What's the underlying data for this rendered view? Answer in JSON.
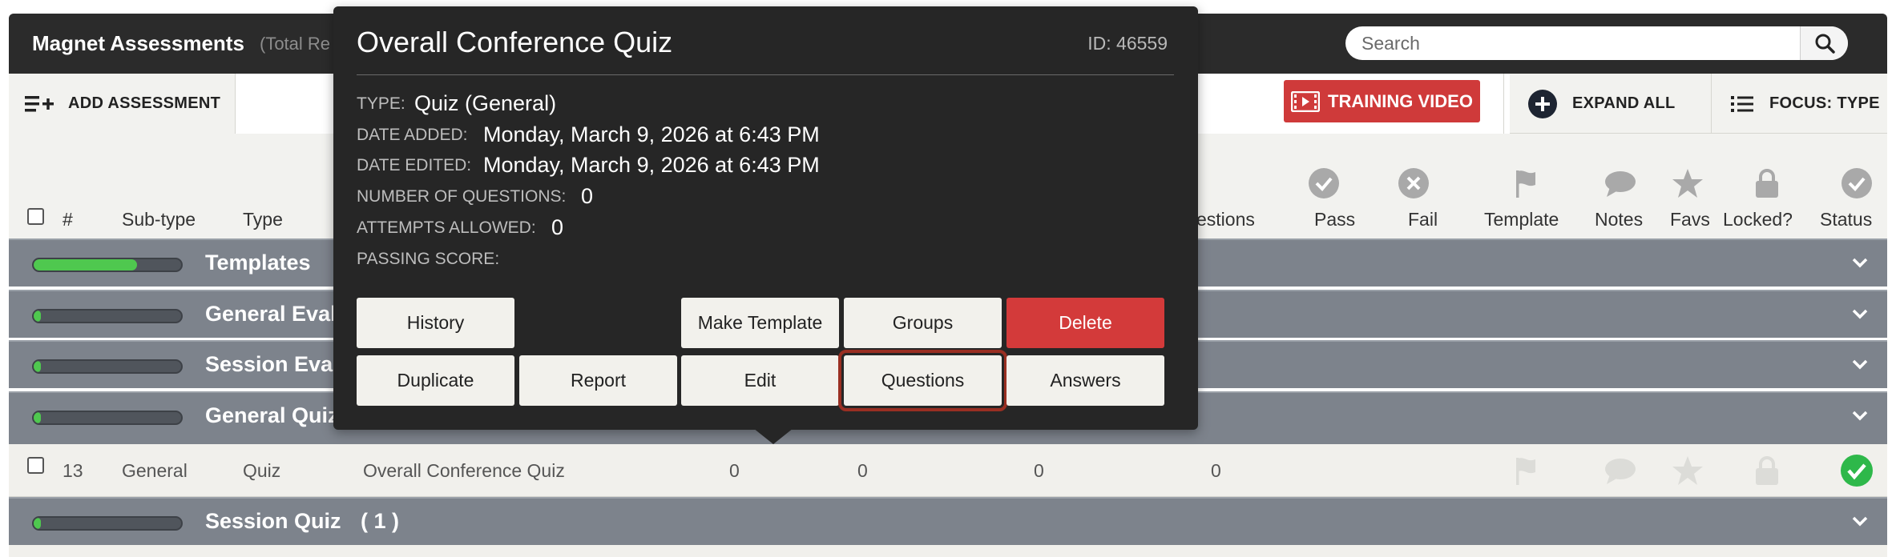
{
  "header": {
    "title": "Magnet Assessments",
    "subtitle": "(Total Re",
    "search_placeholder": "Search"
  },
  "toolbar": {
    "add_label": "ADD ASSESSMENT",
    "training_label": "TRAINING VIDEO",
    "expand_label": "EXPAND ALL",
    "focus_label": "FOCUS: TYPE"
  },
  "columns": {
    "num": "#",
    "subtype": "Sub-type",
    "type": "Type",
    "questions_partial": "estions",
    "pass": "Pass",
    "fail": "Fail",
    "template": "Template",
    "notes": "Notes",
    "favs": "Favs",
    "locked": "Locked?",
    "status": "Status"
  },
  "groups": [
    {
      "label": "Templates",
      "count": "(",
      "progress": 0.7
    },
    {
      "label": "General Eval",
      "progress": 0.05
    },
    {
      "label": "Session Evalu",
      "progress": 0.05
    },
    {
      "label": "General Quiz",
      "progress": 0.05
    },
    {
      "label": "Session Quiz",
      "count": "( 1 )",
      "progress": 0.05
    }
  ],
  "row": {
    "num": "13",
    "subtype": "General",
    "type": "Quiz",
    "name": "Overall Conference Quiz",
    "v1": "0",
    "v2": "0",
    "v3": "0",
    "v4": "0"
  },
  "popover": {
    "title": "Overall Conference Quiz",
    "id": "ID: 46559",
    "fields": [
      {
        "label": "TYPE:",
        "value": "Quiz (General)"
      },
      {
        "label": "DATE ADDED:",
        "value": "Monday, March 9, 2026 at 6:43 PM"
      },
      {
        "label": "DATE EDITED:",
        "value": "Monday, March 9, 2026 at 6:43 PM"
      },
      {
        "label": "NUMBER OF QUESTIONS:",
        "value": "0"
      },
      {
        "label": "ATTEMPTS ALLOWED:",
        "value": "0"
      },
      {
        "label": "PASSING SCORE:",
        "value": ""
      }
    ],
    "buttons": {
      "history": "History",
      "make_template": "Make Template",
      "groups": "Groups",
      "delete": "Delete",
      "duplicate": "Duplicate",
      "report": "Report",
      "edit": "Edit",
      "questions": "Questions",
      "answers": "Answers"
    }
  },
  "colors": {
    "accent_red": "#cf3a3a",
    "group_gray": "#7d838c",
    "progress_green": "#4fc84f",
    "status_green": "#2eb84a",
    "icon_gray": "#a9a9a9"
  }
}
